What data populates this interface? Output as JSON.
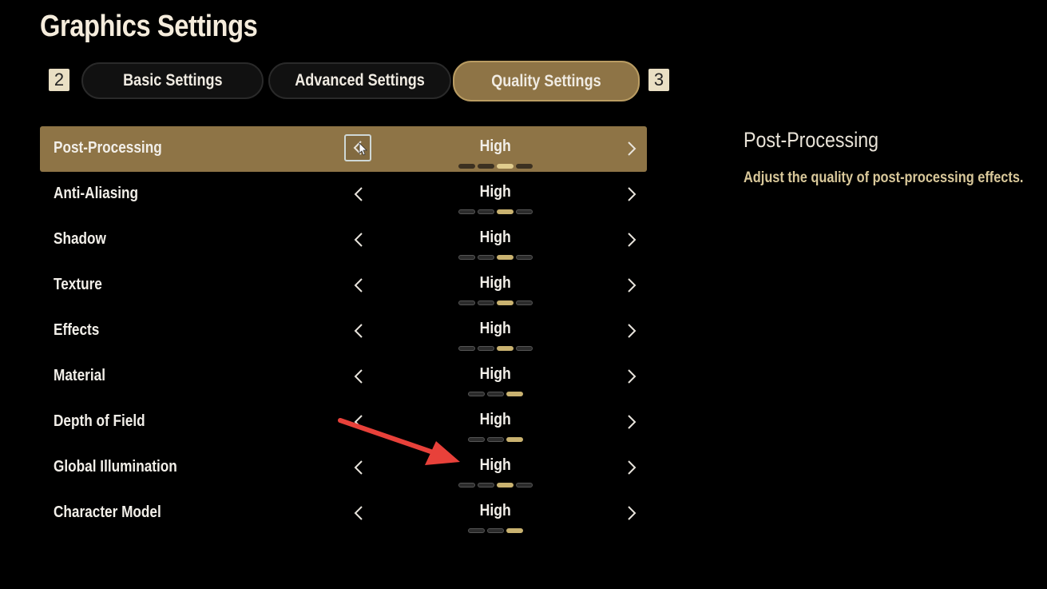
{
  "title": "Graphics Settings",
  "tabs": {
    "prev_key": "2",
    "next_key": "3",
    "items": [
      {
        "label": "Basic Settings"
      },
      {
        "label": "Advanced Settings"
      },
      {
        "label": "Quality Settings"
      }
    ],
    "active": "Quality Settings"
  },
  "settings": [
    {
      "label": "Post-Processing",
      "value": "High",
      "level": 3,
      "levels": 4,
      "selected": true
    },
    {
      "label": "Anti-Aliasing",
      "value": "High",
      "level": 3,
      "levels": 4
    },
    {
      "label": "Shadow",
      "value": "High",
      "level": 3,
      "levels": 4
    },
    {
      "label": "Texture",
      "value": "High",
      "level": 3,
      "levels": 4
    },
    {
      "label": "Effects",
      "value": "High",
      "level": 3,
      "levels": 4
    },
    {
      "label": "Material",
      "value": "High",
      "level": 3,
      "levels": 3
    },
    {
      "label": "Depth of Field",
      "value": "High",
      "level": 3,
      "levels": 3
    },
    {
      "label": "Global Illumination",
      "value": "High",
      "level": 3,
      "levels": 4
    },
    {
      "label": "Character Model",
      "value": "High",
      "level": 3,
      "levels": 3
    }
  ],
  "description": {
    "title": "Post-Processing",
    "text": "Adjust the quality of post-processing effects."
  },
  "icons": {
    "left": "chevron-left-icon",
    "right": "chevron-right-icon",
    "cursor": "mouse-cursor-icon",
    "annotation": "red-arrow-annotation"
  },
  "colors": {
    "accent": "#8e7446",
    "accent_border": "#b99c62",
    "level_on": "#c9b270",
    "description_text": "#d9c89a",
    "annotation": "#e8413a"
  }
}
